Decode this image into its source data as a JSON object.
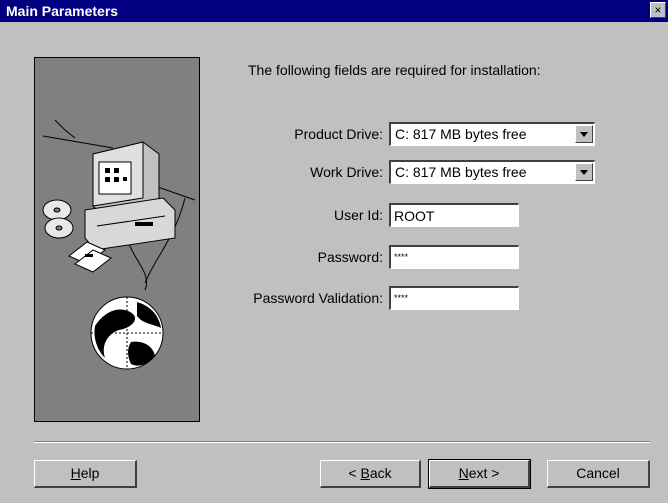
{
  "window": {
    "title": "Main Parameters",
    "close_icon": "close-icon",
    "close_glyph": "×"
  },
  "intro_text": "The following fields are required for installation:",
  "fields": {
    "product_drive": {
      "label": "Product Drive:",
      "value": "C:  817 MB bytes free"
    },
    "work_drive": {
      "label": "Work Drive:",
      "value": "C:  817 MB bytes free"
    },
    "user_id": {
      "label": "User Id:",
      "value": "ROOT"
    },
    "password": {
      "label": "Password:",
      "value": "****"
    },
    "password_validation": {
      "label": "Password Validation:",
      "value": "****"
    }
  },
  "buttons": {
    "help": {
      "mnemonic": "H",
      "rest": "elp"
    },
    "back": {
      "prefix": "< ",
      "mnemonic": "B",
      "rest": "ack"
    },
    "next": {
      "mnemonic": "N",
      "rest": "ext >"
    },
    "cancel": {
      "label": "Cancel"
    }
  },
  "illustration": {
    "icons": [
      "computer-icon",
      "cd-disc-icon",
      "floppy-disk-icon",
      "globe-icon"
    ]
  },
  "colors": {
    "titlebar": "#000080",
    "dialog": "#c0c0c0",
    "side_panel": "#808080"
  }
}
